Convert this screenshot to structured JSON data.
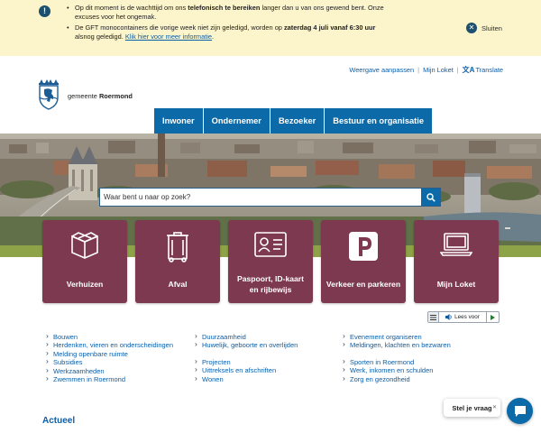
{
  "notice": {
    "icon": "info-icon",
    "item1_pre": "Op dit moment is de wachttijd om ons ",
    "item1_bold": "telefonisch te bereiken",
    "item1_post": " langer dan u van ons gewend bent. Onze excuses voor het ongemak.",
    "item2_pre": "De GFT monocontainers die vorige week niet zijn geledigd, worden op ",
    "item2_bold": "zaterdag 4 juli vanaf 6:30 uur",
    "item2_post": " alsnog geledigd. ",
    "item2_link": "Klik hier voor meer informatie",
    "item2_end": ".",
    "close_label": "Sluiten"
  },
  "header": {
    "links": {
      "weergave": "Weergave aanpassen",
      "mijn_loket": "Mijn Loket",
      "translate": "Translate"
    },
    "logo": {
      "prefix": "gemeente",
      "name": "Roermond"
    },
    "nav": [
      "Inwoner",
      "Ondernemer",
      "Bezoeker",
      "Bestuur en organisatie"
    ]
  },
  "search": {
    "placeholder": "Waar bent u naar op zoek?"
  },
  "tiles": [
    {
      "label": "Verhuizen",
      "icon": "moving-box-icon"
    },
    {
      "label": "Afval",
      "icon": "waste-bin-icon"
    },
    {
      "label": "Paspoort, ID-kaart en rijbewijs",
      "icon": "id-card-icon"
    },
    {
      "label": "Verkeer en parkeren",
      "icon": "parking-icon"
    },
    {
      "label": "Mijn Loket",
      "icon": "laptop-icon"
    }
  ],
  "read_aloud": {
    "label": "Lees voor"
  },
  "links": {
    "col1": [
      "Bouwen",
      "Herdenken, vieren en onderscheidingen",
      "Melding openbare ruimte",
      "Subsidies",
      "Werkzaamheden",
      "Zwemmen in Roermond"
    ],
    "col2": [
      "Duurzaamheid",
      "Huwelijk, geboorte en overlijden",
      "Projecten",
      "Uittreksels en afschriften",
      "Wonen"
    ],
    "col3": [
      "Evenement organiseren",
      "Meldingen, klachten en bezwaren",
      "Sporten in Roermond",
      "Werk, inkomen en schulden",
      "Zorg en gezondheid"
    ]
  },
  "section_title": "Actueel",
  "chat": {
    "bubble": "Stel je vraag",
    "icon": "chat-icon"
  },
  "colors": {
    "notice_bg": "#fcf4cb",
    "nav_blue": "#0c6aa8",
    "tile_wine": "#7d394f",
    "link_blue": "#0b5ea8"
  }
}
